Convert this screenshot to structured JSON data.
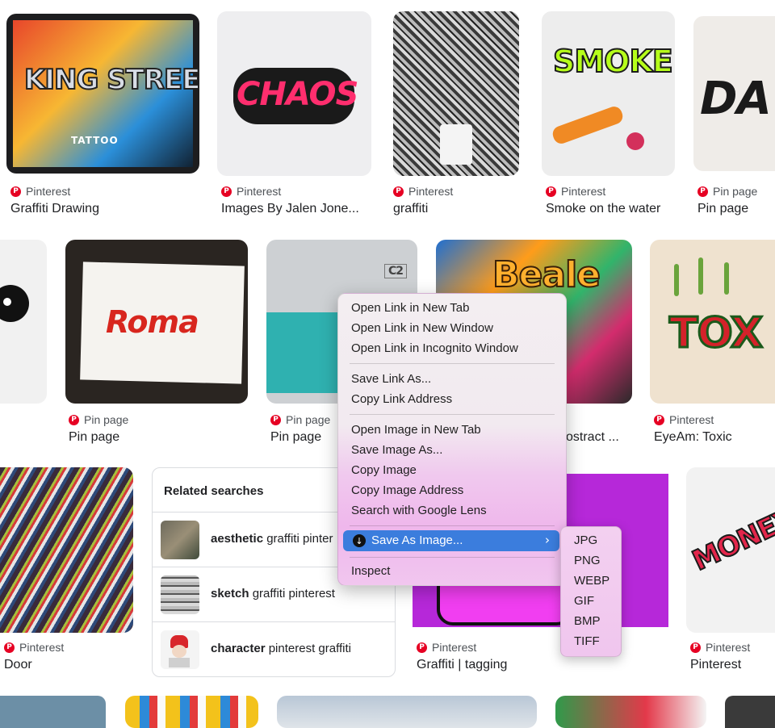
{
  "rows": [
    [
      {
        "source": "Pinterest",
        "title": "Graffiti Drawing",
        "art": "KING STREET",
        "sub": "TATTOO"
      },
      {
        "source": "Pinterest",
        "title": "Images By Jalen Jone...",
        "art": "CHAOS"
      },
      {
        "source": "Pinterest",
        "title": "graffiti"
      },
      {
        "source": "Pinterest",
        "title": "Smoke on the water",
        "art": "SMOKE"
      },
      {
        "source": "Pin page",
        "title": "Pin page",
        "art": "DA"
      }
    ],
    [
      {
        "source": "Pin page",
        "title": "Pin page"
      },
      {
        "source": "Pin page",
        "title": "Pin page",
        "art": "Roma"
      },
      {
        "source": "Pin page",
        "title": "Pin page",
        "art": "C2"
      },
      {
        "source": "",
        "title": "ostract ...",
        "art": "Beale"
      },
      {
        "source": "Pinterest",
        "title": "EyeAm: Toxic",
        "art": "TOX"
      }
    ],
    [
      {
        "source": "Pinterest",
        "title": "Door"
      },
      {
        "source": "Pinterest",
        "title": "Graffiti | tagging"
      },
      {
        "source": "Pinterest",
        "title": "Pinterest",
        "art": "MONEY"
      }
    ]
  ],
  "related": {
    "heading": "Related searches",
    "items": [
      {
        "bold": "aesthetic",
        "rest": " graffiti pinter"
      },
      {
        "bold": "sketch",
        "rest": " graffiti pinterest"
      },
      {
        "bold": "character",
        "rest": " pinterest graffiti"
      }
    ]
  },
  "context_menu": {
    "items": [
      "Open Link in New Tab",
      "Open Link in New Window",
      "Open Link in Incognito Window",
      "Save Link As...",
      "Copy Link Address",
      "Open Image in New Tab",
      "Save Image As...",
      "Copy Image",
      "Copy Image Address",
      "Search with Google Lens",
      "Save As Image...",
      "Inspect"
    ],
    "submenu": [
      "JPG",
      "PNG",
      "WEBP",
      "GIF",
      "BMP",
      "TIFF"
    ],
    "highlight_color": "#3b7ddd"
  },
  "colors": {
    "pinterest": "#e60023",
    "text": "#202124",
    "meta": "#4d5156"
  }
}
